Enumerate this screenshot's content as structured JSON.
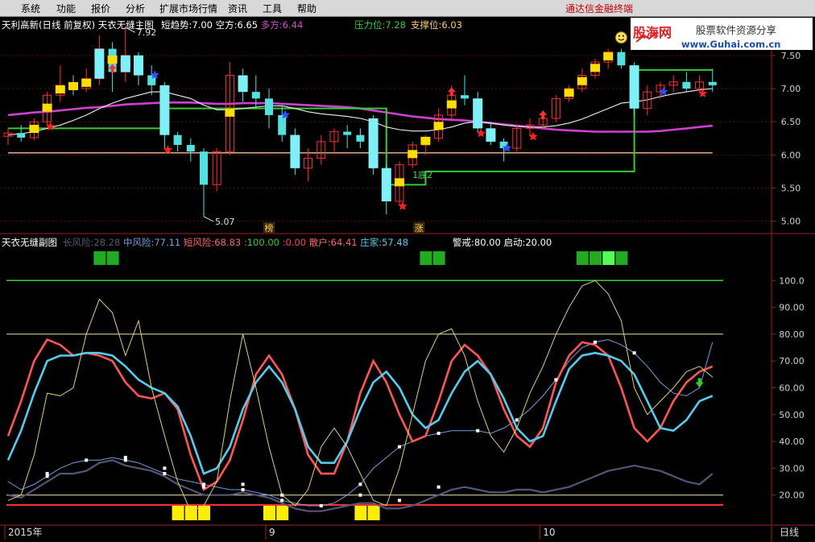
{
  "menu": {
    "items": [
      "系统",
      "功能",
      "报价",
      "分析",
      "扩展市场行情",
      "资讯",
      "工具",
      "帮助"
    ],
    "promo": "通达信金融终端"
  },
  "watermark": {
    "brand": "股海网",
    "slogan": "股票软件资源分享",
    "url": "www.Guhai.com.cn"
  },
  "main_pane": {
    "title": "天利高新(日线 前复权) 天衣无缝主图",
    "readouts": [
      {
        "label": "短趋势:",
        "value": "7.00",
        "color": "#ffffff"
      },
      {
        "label": "空方:",
        "value": "6.65",
        "color": "#ffffff"
      },
      {
        "label": "多方:",
        "value": "6.44",
        "color": "#d24ad2"
      }
    ],
    "pressure": {
      "label": "压力位:",
      "value": "7.28",
      "color": "#33cc33"
    },
    "support": {
      "label": "支撑位:",
      "value": "6.03",
      "color": "#ffcc66"
    },
    "high_label": "7.92",
    "low_label": "5.07",
    "bottom_label": "1底2",
    "tag1": "榜",
    "tag2": "涨"
  },
  "sub_pane": {
    "title": "天衣无缝副图",
    "readouts": [
      {
        "label": "长风险:",
        "value": "28.28",
        "color": "#555577"
      },
      {
        "label": "中风险:",
        "value": "77.11",
        "color": "#6fa0e0"
      },
      {
        "label": "短风险:",
        "value": "68.83",
        "color": "#ff6666"
      },
      {
        "label": ":",
        "value": "100.00",
        "color": "#33cc33"
      },
      {
        "label": ":",
        "value": "0.00",
        "color": "#ff4444"
      },
      {
        "label": "散户:",
        "value": "64.41",
        "color": "#ff6666"
      },
      {
        "label": "庄家:",
        "value": "57.48",
        "color": "#55ccee"
      },
      {
        "label": "警戒:",
        "value": "80.00",
        "color": "#ffffff"
      },
      {
        "label": "启动:",
        "value": "20.00",
        "color": "#ffffff"
      }
    ]
  },
  "x_axis": {
    "labels": [
      {
        "text": "2015年",
        "index": 0
      },
      {
        "text": "9",
        "index": 20
      },
      {
        "text": "10",
        "index": 41
      }
    ],
    "period": "日线"
  },
  "chart_data": [
    {
      "type": "candlestick",
      "title": "天利高新(日线 前复权) 天衣无缝主图",
      "ylim": [
        4.85,
        7.85
      ],
      "yticks": [
        5.0,
        5.5,
        6.0,
        6.5,
        7.0,
        7.5
      ],
      "ohlc": [
        [
          6.28,
          6.4,
          6.15,
          6.33
        ],
        [
          6.33,
          6.45,
          6.2,
          6.26
        ],
        [
          6.26,
          6.55,
          6.22,
          6.5
        ],
        [
          6.5,
          6.95,
          6.45,
          6.9
        ],
        [
          6.9,
          7.35,
          6.8,
          7.05
        ],
        [
          7.05,
          7.2,
          6.9,
          7.0
        ],
        [
          7.0,
          7.3,
          6.95,
          7.15
        ],
        [
          7.15,
          7.8,
          7.05,
          7.6
        ],
        [
          7.6,
          7.7,
          6.95,
          7.25
        ],
        [
          7.25,
          7.92,
          7.1,
          7.5
        ],
        [
          7.5,
          7.55,
          7.05,
          7.2
        ],
        [
          7.2,
          7.35,
          6.9,
          7.05
        ],
        [
          7.05,
          7.1,
          6.1,
          6.3
        ],
        [
          6.3,
          6.35,
          6.05,
          6.15
        ],
        [
          6.15,
          6.25,
          5.9,
          6.05
        ],
        [
          6.05,
          6.1,
          5.07,
          5.55
        ],
        [
          5.55,
          6.1,
          5.45,
          6.05
        ],
        [
          6.05,
          7.4,
          6.0,
          7.2
        ],
        [
          7.2,
          7.3,
          6.8,
          6.95
        ],
        [
          6.95,
          7.2,
          6.7,
          6.85
        ],
        [
          6.85,
          7.0,
          6.4,
          6.6
        ],
        [
          6.6,
          6.75,
          6.2,
          6.3
        ],
        [
          6.3,
          6.4,
          5.7,
          5.8
        ],
        [
          5.8,
          6.1,
          5.6,
          5.95
        ],
        [
          5.95,
          6.3,
          5.85,
          6.2
        ],
        [
          6.2,
          6.4,
          6.05,
          6.35
        ],
        [
          6.35,
          6.45,
          6.1,
          6.3
        ],
        [
          6.3,
          6.4,
          6.1,
          6.2
        ],
        [
          6.55,
          6.6,
          5.7,
          5.8
        ],
        [
          5.8,
          5.85,
          5.1,
          5.3
        ],
        [
          5.3,
          5.9,
          5.25,
          5.85
        ],
        [
          5.85,
          6.2,
          5.8,
          6.15
        ],
        [
          6.15,
          6.3,
          6.0,
          6.25
        ],
        [
          6.25,
          6.7,
          6.2,
          6.6
        ],
        [
          6.6,
          7.05,
          6.55,
          6.9
        ],
        [
          6.9,
          7.2,
          6.75,
          6.85
        ],
        [
          6.85,
          6.95,
          6.35,
          6.4
        ],
        [
          6.4,
          6.5,
          6.15,
          6.2
        ],
        [
          6.2,
          6.25,
          5.9,
          6.1
        ],
        [
          6.1,
          6.45,
          6.05,
          6.4
        ],
        [
          6.4,
          6.55,
          6.3,
          6.45
        ],
        [
          6.45,
          6.6,
          6.4,
          6.55
        ],
        [
          6.55,
          6.9,
          6.5,
          6.85
        ],
        [
          6.85,
          7.05,
          6.8,
          7.0
        ],
        [
          7.0,
          7.3,
          6.95,
          7.2
        ],
        [
          7.2,
          7.45,
          7.15,
          7.4
        ],
        [
          7.4,
          7.6,
          7.3,
          7.55
        ],
        [
          7.55,
          7.6,
          7.3,
          7.35
        ],
        [
          7.35,
          7.4,
          6.6,
          6.7
        ],
        [
          6.7,
          7.05,
          6.6,
          6.95
        ],
        [
          6.95,
          7.1,
          6.85,
          7.05
        ],
        [
          7.05,
          7.2,
          6.95,
          7.1
        ],
        [
          7.1,
          7.25,
          6.95,
          7.0
        ],
        [
          7.0,
          7.2,
          6.95,
          7.1
        ],
        [
          7.1,
          7.3,
          6.95,
          7.05
        ]
      ],
      "overlays": {
        "white_ma": [
          6.3,
          6.32,
          6.35,
          6.4,
          6.45,
          6.52,
          6.6,
          6.7,
          6.78,
          6.85,
          6.9,
          6.95,
          6.95,
          6.9,
          6.85,
          6.75,
          6.68,
          6.68,
          6.7,
          6.72,
          6.74,
          6.74,
          6.7,
          6.65,
          6.62,
          6.6,
          6.58,
          6.55,
          6.5,
          6.42,
          6.38,
          6.36,
          6.36,
          6.38,
          6.42,
          6.48,
          6.5,
          6.48,
          6.45,
          6.43,
          6.42,
          6.42,
          6.44,
          6.48,
          6.54,
          6.62,
          6.7,
          6.78,
          6.8,
          6.83,
          6.88,
          6.92,
          6.95,
          6.98,
          7.0
        ],
        "magenta_ma": [
          6.6,
          6.62,
          6.64,
          6.65,
          6.67,
          6.69,
          6.71,
          6.72,
          6.74,
          6.76,
          6.77,
          6.78,
          6.79,
          6.79,
          6.79,
          6.78,
          6.77,
          6.77,
          6.78,
          6.78,
          6.78,
          6.77,
          6.76,
          6.75,
          6.74,
          6.73,
          6.72,
          6.7,
          6.67,
          6.64,
          6.61,
          6.58,
          6.56,
          6.54,
          6.53,
          6.52,
          6.5,
          6.48,
          6.46,
          6.44,
          6.42,
          6.4,
          6.38,
          6.37,
          6.36,
          6.35,
          6.35,
          6.35,
          6.35,
          6.35,
          6.36,
          6.38,
          6.4,
          6.42,
          6.44
        ],
        "pressure_line": [
          6.4,
          6.4,
          6.4,
          6.4,
          6.4,
          6.4,
          6.4,
          6.4,
          6.4,
          6.4,
          6.4,
          6.4,
          6.7,
          6.7,
          6.7,
          6.7,
          6.7,
          6.7,
          6.7,
          6.7,
          6.7,
          6.7,
          6.7,
          6.7,
          6.7,
          6.7,
          6.7,
          6.7,
          6.7,
          5.55,
          5.55,
          5.55,
          5.75,
          5.75,
          5.75,
          5.75,
          5.75,
          5.75,
          5.75,
          5.75,
          5.75,
          5.75,
          5.75,
          5.75,
          5.75,
          5.75,
          5.75,
          5.75,
          7.28,
          7.28,
          7.28,
          7.28,
          7.28,
          7.28,
          7.28
        ],
        "support_line": [
          6.03,
          6.03,
          6.03,
          6.03,
          6.03,
          6.03,
          6.03,
          6.03,
          6.03,
          6.03,
          6.03,
          6.03,
          6.03,
          6.03,
          6.03,
          6.03,
          6.03,
          6.03,
          6.03,
          6.03,
          6.03,
          6.03,
          6.03,
          6.03,
          6.03,
          6.03,
          6.03,
          6.03,
          6.03,
          6.03,
          6.03,
          6.03,
          6.03,
          6.03,
          6.03,
          6.03,
          6.03,
          6.03,
          6.03,
          6.03,
          6.03,
          6.03,
          6.03,
          6.03,
          6.03,
          6.03,
          6.03,
          6.03,
          6.03,
          6.03,
          6.03,
          6.03,
          6.03,
          6.03,
          6.03
        ]
      },
      "yellow_bar_indices": [
        2,
        3,
        4,
        5,
        6,
        8,
        9,
        17,
        18,
        30,
        31,
        32,
        33,
        34,
        43,
        44,
        45,
        46
      ],
      "cyan_bar_indices": [
        7,
        9,
        10,
        12,
        18,
        22,
        28,
        29,
        36,
        37,
        48
      ],
      "red_star_indices": [
        3,
        12,
        30,
        36,
        40,
        53
      ],
      "blue_star_indices": [
        11,
        21,
        38,
        50
      ],
      "up_arrow_indices": [
        8,
        34,
        41
      ],
      "smiley_index": 47
    },
    {
      "type": "line",
      "title": "天衣无缝副图",
      "ylim": [
        10,
        110
      ],
      "yticks": [
        20.0,
        30.0,
        40.0,
        50.0,
        60.0,
        70.0,
        80.0,
        90.0,
        100.0
      ],
      "reference_lines": {
        "警戒": 80,
        "启动": 20,
        "top": 100
      },
      "series": [
        {
          "name": "长风险",
          "color": "#555577",
          "values": [
            20,
            19,
            22,
            25,
            28,
            28,
            29,
            32,
            33,
            31,
            30,
            29,
            27,
            24,
            22,
            20,
            20,
            20,
            21,
            20,
            19,
            17,
            15,
            14,
            14,
            15,
            16,
            17,
            17,
            15,
            15,
            16,
            18,
            20,
            22,
            23,
            22,
            21,
            21,
            22,
            22,
            21,
            22,
            23,
            25,
            27,
            29,
            30,
            31,
            30,
            29,
            27,
            25,
            24,
            28
          ]
        },
        {
          "name": "中风险",
          "color": "#6fa0e0",
          "values": [
            25,
            22,
            24,
            27,
            30,
            32,
            33,
            33,
            34,
            33,
            32,
            30,
            28,
            26,
            25,
            24,
            23,
            22,
            22,
            21,
            20,
            18,
            17,
            16,
            16,
            17,
            20,
            24,
            30,
            34,
            38,
            40,
            42,
            43,
            44,
            44,
            44,
            43,
            45,
            48,
            52,
            57,
            63,
            70,
            75,
            77,
            78,
            76,
            73,
            68,
            62,
            58,
            57,
            60,
            77
          ]
        },
        {
          "name": "短风险",
          "color": "#ff5555",
          "values": [
            42,
            55,
            70,
            78,
            76,
            72,
            73,
            72,
            70,
            62,
            57,
            56,
            58,
            52,
            35,
            22,
            25,
            33,
            48,
            65,
            72,
            65,
            52,
            35,
            28,
            28,
            40,
            58,
            70,
            62,
            50,
            40,
            42,
            55,
            70,
            76,
            72,
            65,
            52,
            42,
            38,
            45,
            62,
            72,
            77,
            76,
            72,
            60,
            45,
            40,
            45,
            55,
            62,
            66,
            68
          ]
        },
        {
          "name": "庄家",
          "color": "#55ccee",
          "values": [
            33,
            44,
            58,
            70,
            72,
            72,
            73,
            73,
            72,
            68,
            63,
            60,
            58,
            53,
            42,
            28,
            30,
            38,
            52,
            62,
            68,
            62,
            52,
            38,
            32,
            32,
            40,
            52,
            62,
            66,
            60,
            50,
            45,
            48,
            58,
            66,
            70,
            65,
            56,
            45,
            40,
            42,
            55,
            67,
            72,
            73,
            72,
            70,
            65,
            55,
            45,
            44,
            48,
            55,
            57
          ]
        },
        {
          "name": "散户",
          "color": "#e0d070",
          "values": [
            18,
            20,
            35,
            58,
            57,
            60,
            80,
            93,
            88,
            72,
            85,
            60,
            42,
            25,
            14,
            16,
            25,
            55,
            80,
            60,
            38,
            20,
            16,
            22,
            38,
            45,
            38,
            28,
            18,
            16,
            30,
            50,
            70,
            80,
            82,
            72,
            55,
            42,
            36,
            45,
            58,
            68,
            80,
            90,
            98,
            100,
            95,
            85,
            60,
            50,
            55,
            60,
            66,
            68,
            64
          ]
        }
      ],
      "green_signal_indices": [
        7,
        8,
        32,
        33,
        44,
        45,
        46,
        47
      ],
      "yellow_signal_indices": [
        13,
        14,
        15,
        20,
        21,
        27,
        28
      ]
    }
  ]
}
